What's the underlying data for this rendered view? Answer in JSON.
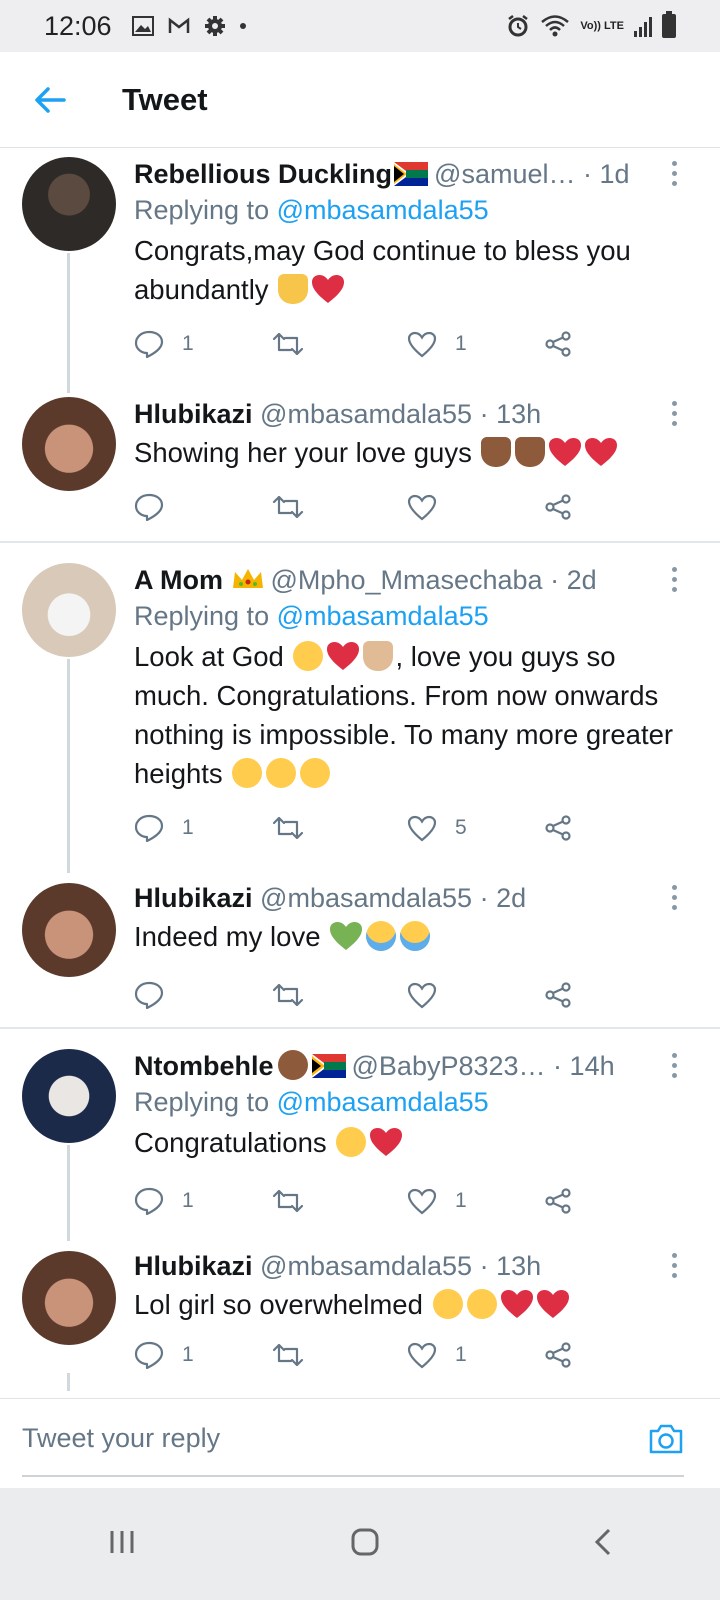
{
  "status": {
    "time": "12:06",
    "lte": "Vo)) LTE"
  },
  "header": {
    "title": "Tweet"
  },
  "tweets": [
    {
      "name": "Rebellious Duckling",
      "handle": "@samuel…",
      "sep": " · ",
      "time": "1d",
      "replying_prefix": "Replying to ",
      "replying_to": "@mbasamdala55",
      "text": "Congrats,may God continue to bless you abundantly",
      "reply_count": "1",
      "retweet_count": "",
      "like_count": "1"
    },
    {
      "name": "Hlubikazi",
      "handle": "@mbasamdala55",
      "sep": " · ",
      "time": "13h",
      "text": "Showing her your love guys",
      "reply_count": "",
      "retweet_count": "",
      "like_count": ""
    },
    {
      "name": "A Mom",
      "handle": "@Mpho_Mmasechaba",
      "sep": " · ",
      "time": "2d",
      "replying_prefix": "Replying to ",
      "replying_to": "@mbasamdala55",
      "text_a": "Look at God",
      "text_b": ", love you guys so much. Congratulations. From now onwards nothing is impossible. To many more greater heights",
      "reply_count": "1",
      "retweet_count": "",
      "like_count": "5"
    },
    {
      "name": "Hlubikazi",
      "handle": "@mbasamdala55",
      "sep": " · ",
      "time": "2d",
      "text": "Indeed my love",
      "reply_count": "",
      "retweet_count": "",
      "like_count": ""
    },
    {
      "name": "Ntombehle",
      "handle": "@BabyP8323…",
      "sep": " · ",
      "time": "14h",
      "replying_prefix": "Replying to ",
      "replying_to": "@mbasamdala55",
      "text": "Congratulations",
      "reply_count": "1",
      "retweet_count": "",
      "like_count": "1"
    },
    {
      "name": "Hlubikazi",
      "handle": "@mbasamdala55",
      "sep": " · ",
      "time": "13h",
      "text": "Lol girl so overwhelmed",
      "reply_count": "1",
      "retweet_count": "",
      "like_count": "1"
    }
  ],
  "reply": {
    "placeholder": "Tweet your reply"
  },
  "colors": {
    "accent": "#1da1f2",
    "heart": "#e0245e",
    "muted": "#657786"
  },
  "icons": {
    "back": "arrow-left-icon",
    "reply": "comment-icon",
    "retweet": "retweet-icon",
    "like": "heart-icon",
    "share": "share-icon",
    "camera": "camera-icon"
  }
}
